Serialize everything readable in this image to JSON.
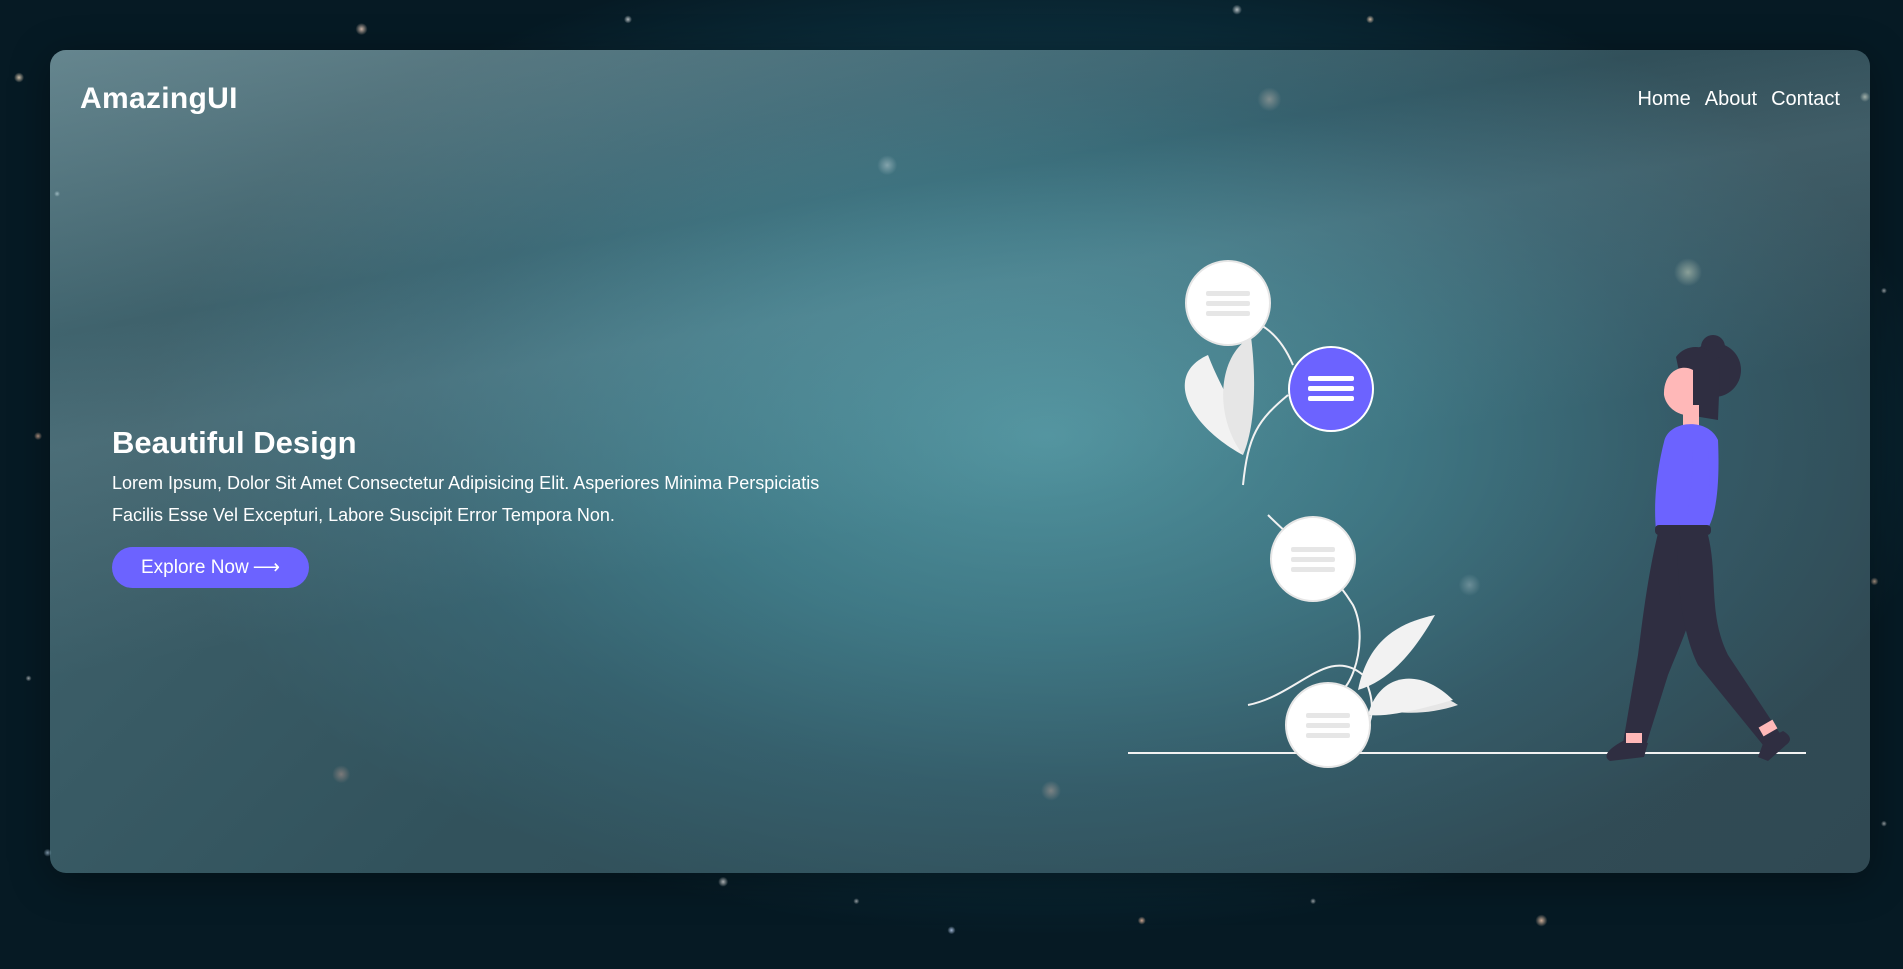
{
  "header": {
    "logo": "AmazingUI",
    "nav": [
      {
        "label": "Home"
      },
      {
        "label": "About"
      },
      {
        "label": "Contact"
      }
    ]
  },
  "hero": {
    "title": "Beautiful Design",
    "description": "Lorem Ipsum, Dolor Sit Amet Consectetur Adipisicing Elit. Asperiores Minima Perspiciatis Facilis Esse Vel Excepturi, Labore Suscipit Error Tempora Non.",
    "cta_label": "Explore Now",
    "cta_arrow": "⟶"
  },
  "colors": {
    "accent": "#6c63ff",
    "text": "#ffffff",
    "figure_dark": "#2f2e41",
    "skin": "#ffb8b8"
  },
  "icons": [
    "menu-lines-icon",
    "arrow-right-icon"
  ]
}
